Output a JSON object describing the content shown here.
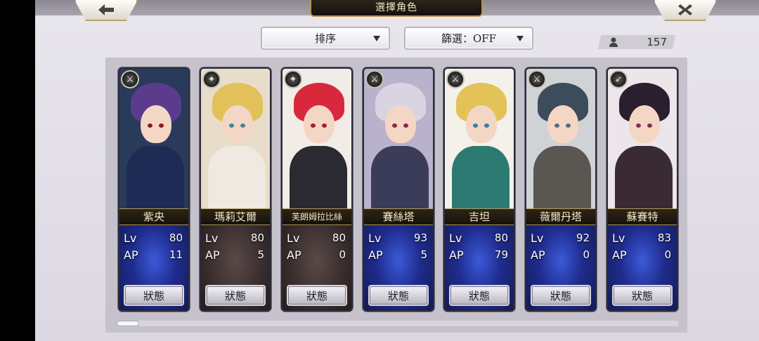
{
  "screen_title": "選擇角色",
  "sort_dropdown": {
    "label": "排序"
  },
  "filter_dropdown": {
    "label": "篩選：OFF"
  },
  "character_count": "157",
  "status_label": "狀態",
  "stat_labels": {
    "lv": "Lv",
    "ap": "AP"
  },
  "cards": [
    {
      "name": "紫央",
      "lv": "80",
      "ap": "11",
      "class_icon": "sword-icon",
      "hair": "#5b3b8c",
      "body": "#1f2b55",
      "eye": "#8a1a1a",
      "bg": "#2a3a5a"
    },
    {
      "name": "瑪莉艾爾",
      "lv": "80",
      "ap": "5",
      "class_icon": "staff-icon",
      "hair": "#e2c15a",
      "body": "#efe9e2",
      "eye": "#3a8a9a",
      "bg": "#e8dccb"
    },
    {
      "name": "芙朗姆拉比絲",
      "lv": "80",
      "ap": "0",
      "class_icon": "staff-icon",
      "hair": "#d8283c",
      "body": "#2b2a30",
      "eye": "#a81a2a",
      "bg": "#f2ece8"
    },
    {
      "name": "賽絲塔",
      "lv": "93",
      "ap": "5",
      "class_icon": "sword-icon",
      "hair": "#d9d4e2",
      "body": "#3a3c5a",
      "eye": "#8a2a3a",
      "bg": "#b8b2cc"
    },
    {
      "name": "吉坦",
      "lv": "80",
      "ap": "79",
      "class_icon": "sword-icon",
      "hair": "#e3c258",
      "body": "#2d7a72",
      "eye": "#3a7aa8",
      "bg": "#f4f1ea"
    },
    {
      "name": "薇爾丹塔",
      "lv": "92",
      "ap": "0",
      "class_icon": "sword-icon",
      "hair": "#3d4c5a",
      "body": "#5a5652",
      "eye": "#5a6a7a",
      "bg": "#cfd3d6"
    },
    {
      "name": "蘇賽特",
      "lv": "83",
      "ap": "0",
      "class_icon": "bow-icon",
      "hair": "#2a1f2e",
      "body": "#3a2a32",
      "eye": "#8a2a5a",
      "bg": "#ece6ea"
    }
  ]
}
